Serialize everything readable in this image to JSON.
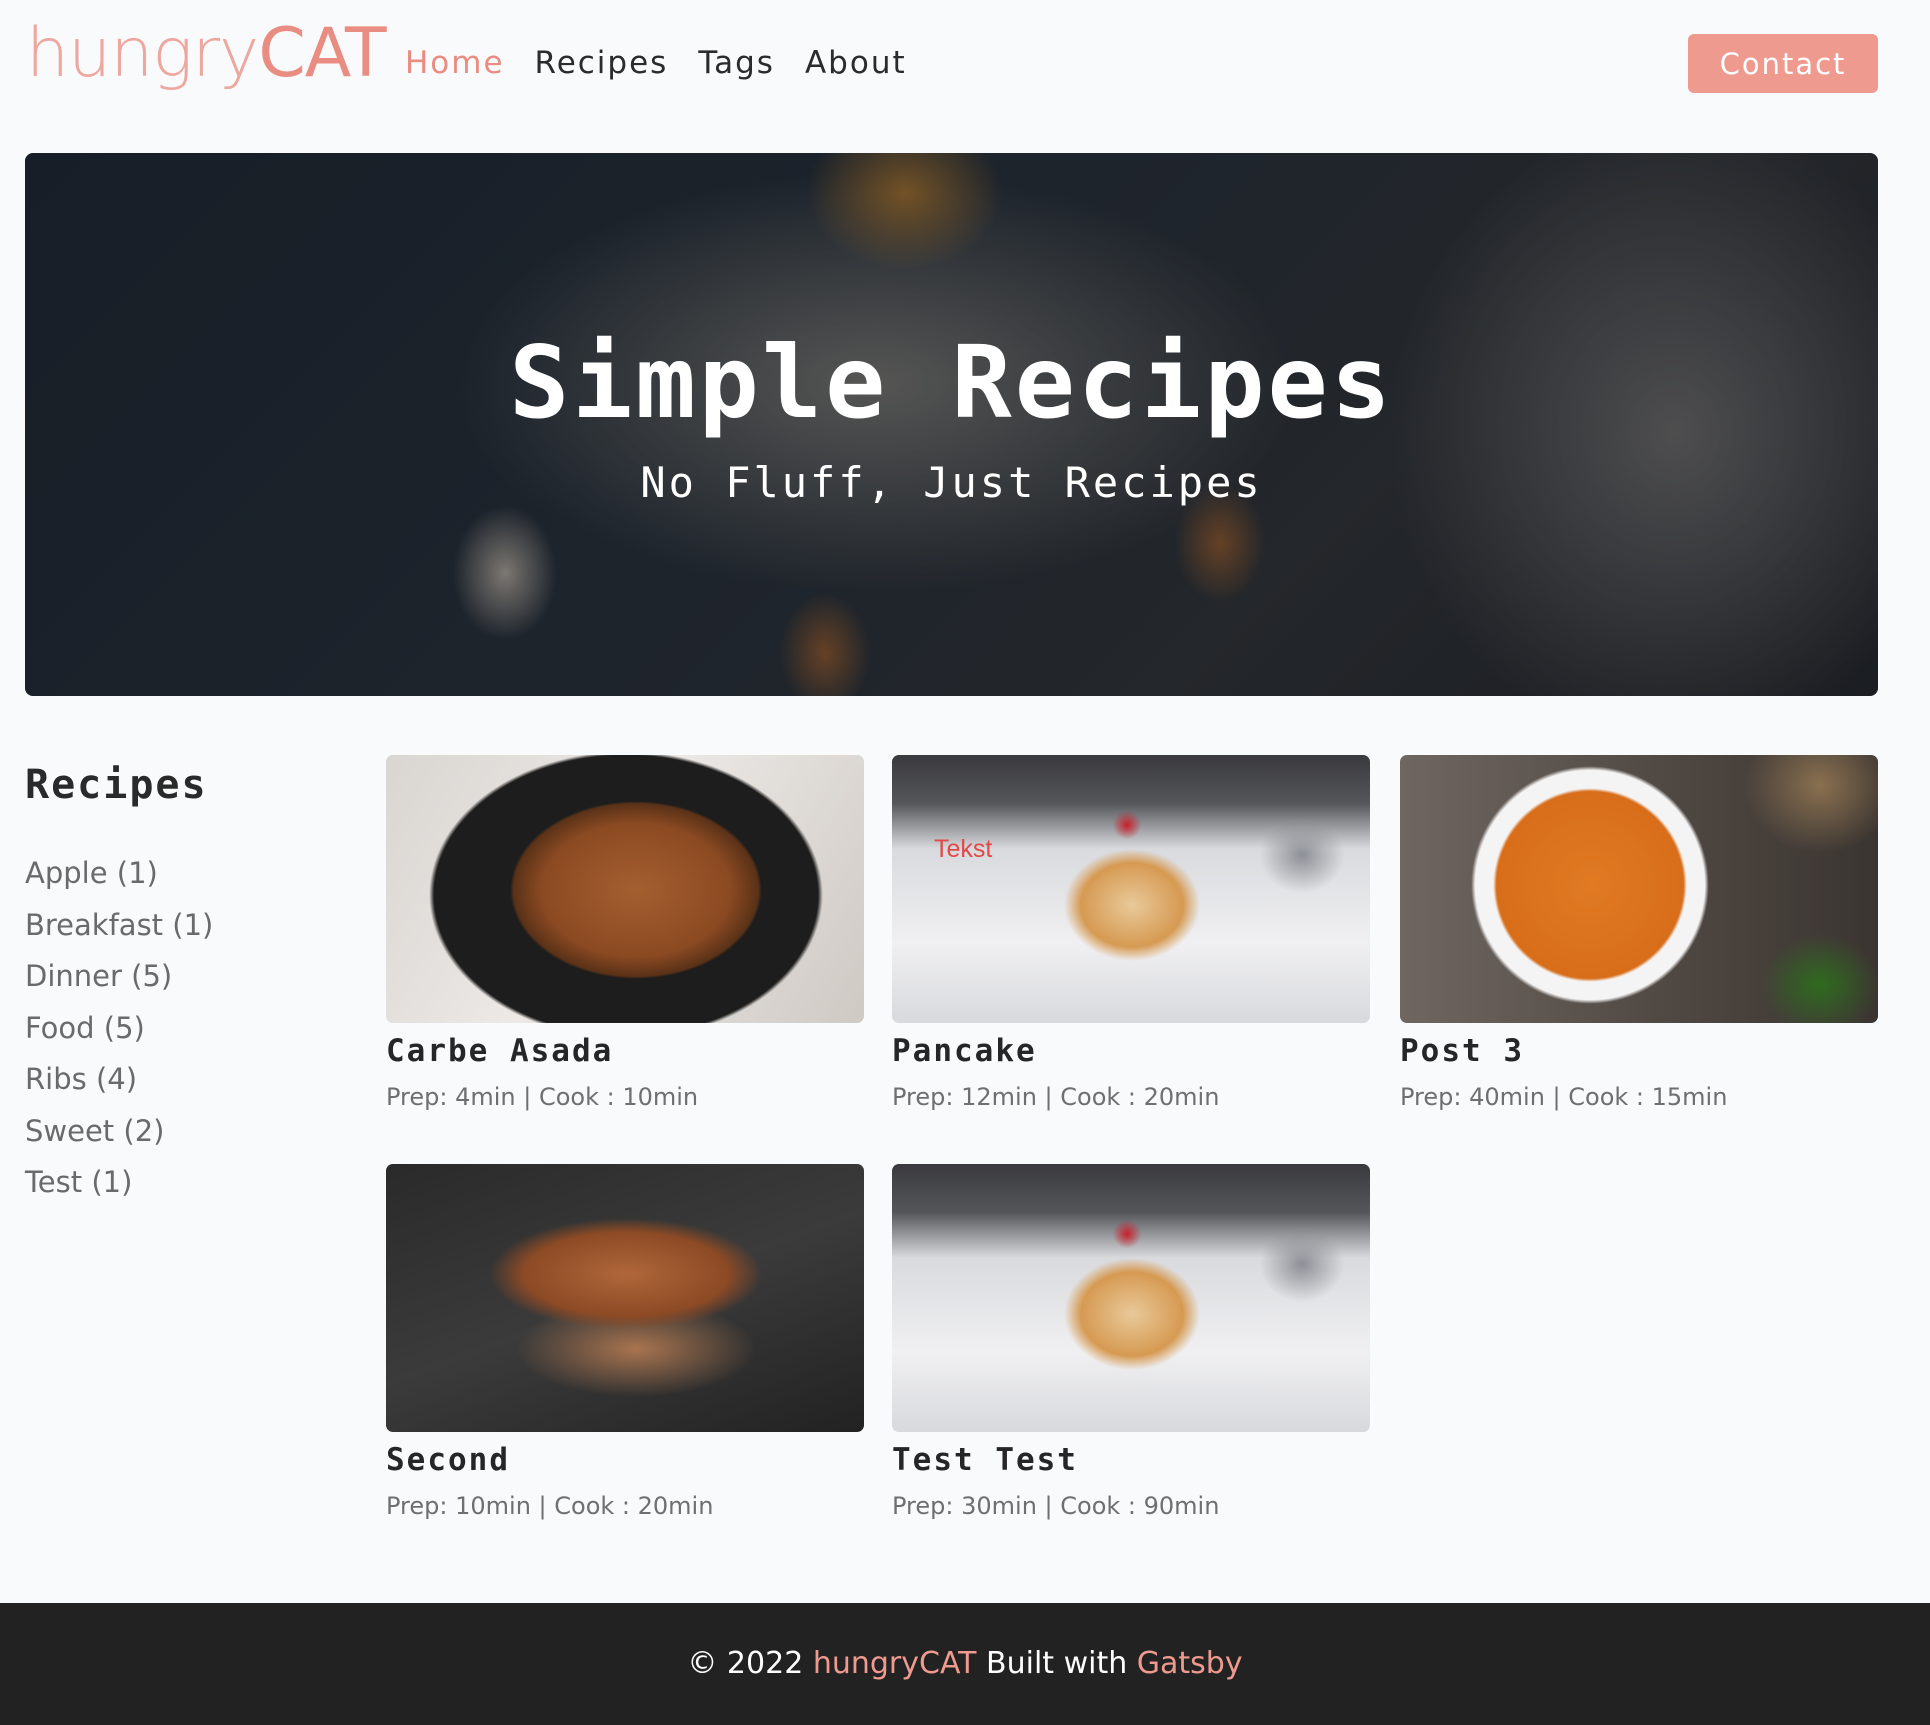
{
  "header": {
    "logo_light": "hungry",
    "logo_bold": "CAT",
    "nav": [
      {
        "label": "Home",
        "active": true
      },
      {
        "label": "Recipes",
        "active": false
      },
      {
        "label": "Tags",
        "active": false
      },
      {
        "label": "About",
        "active": false
      }
    ],
    "contact_label": "Contact"
  },
  "hero": {
    "title": "Simple Recipes",
    "subtitle": "No Fluff, Just Recipes"
  },
  "sidebar": {
    "title": "Recipes",
    "tags": [
      "Apple (1)",
      "Breakfast (1)",
      "Dinner (5)",
      "Food (5)",
      "Ribs (4)",
      "Sweet (2)",
      "Test (1)"
    ]
  },
  "recipes": [
    {
      "title": "Carbe Asada",
      "meta": "Prep: 4min | Cook : 10min"
    },
    {
      "title": "Pancake",
      "meta": "Prep: 12min | Cook : 20min",
      "image_overlay": "Tekst"
    },
    {
      "title": "Post 3",
      "meta": "Prep: 40min | Cook : 15min"
    },
    {
      "title": "Second",
      "meta": "Prep: 10min | Cook : 20min"
    },
    {
      "title": "Test Test",
      "meta": "Prep: 30min | Cook : 90min"
    }
  ],
  "footer": {
    "copyright": "© 2022",
    "brand": "hungryCAT",
    "built_with": "Built with",
    "framework": "Gatsby"
  },
  "colors": {
    "accent": "#ef9a8f",
    "background": "#f8fafc",
    "footer_bg": "#222222"
  }
}
